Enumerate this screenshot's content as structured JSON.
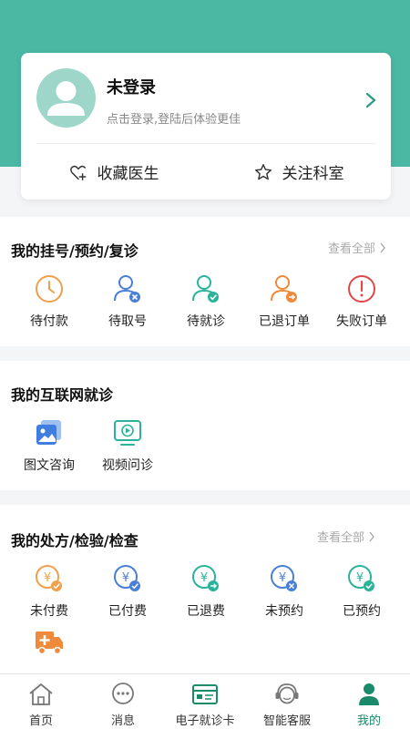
{
  "colors": {
    "hero": "#4ab8a3",
    "accent": "#1a8a6a",
    "clock": "#f0a04b",
    "blue": "#4a7fd8",
    "teal": "#2bb39a",
    "orange": "#f08a3b",
    "red": "#e04848"
  },
  "login_card": {
    "title": "未登录",
    "subtitle": "点击登录,登陆后体验更佳",
    "actions": [
      {
        "label": "收藏医生",
        "icon": "heart-plus-icon"
      },
      {
        "label": "关注科室",
        "icon": "star-outline-icon"
      }
    ]
  },
  "registration": {
    "title": "我的挂号/预约/复诊",
    "view_all": "查看全部",
    "items": [
      {
        "label": "待付款",
        "icon": "clock-icon"
      },
      {
        "label": "待取号",
        "icon": "user-cancel-icon"
      },
      {
        "label": "待就诊",
        "icon": "user-check-icon"
      },
      {
        "label": "已退订单",
        "icon": "user-return-icon"
      },
      {
        "label": "失败订单",
        "icon": "alert-circle-icon"
      }
    ]
  },
  "online": {
    "title": "我的互联网就诊",
    "items": [
      {
        "label": "图文咨询",
        "icon": "image-consult-icon"
      },
      {
        "label": "视频问诊",
        "icon": "video-consult-icon"
      }
    ]
  },
  "prescription": {
    "title": "我的处方/检验/检查",
    "view_all": "查看全部",
    "items": [
      {
        "label": "未付费",
        "icon": "yuan-pending-icon"
      },
      {
        "label": "已付费",
        "icon": "yuan-paid-icon"
      },
      {
        "label": "已退费",
        "icon": "yuan-refund-icon"
      },
      {
        "label": "未预约",
        "icon": "yuan-unbooked-icon"
      },
      {
        "label": "已预约",
        "icon": "yuan-booked-icon"
      }
    ],
    "extra_icon": "medical-truck-icon"
  },
  "tabbar": {
    "items": [
      {
        "label": "首页",
        "icon": "home-icon"
      },
      {
        "label": "消息",
        "icon": "message-icon"
      },
      {
        "label": "电子就诊卡",
        "icon": "card-icon"
      },
      {
        "label": "智能客服",
        "icon": "service-icon"
      },
      {
        "label": "我的",
        "icon": "profile-icon",
        "active": true
      }
    ]
  }
}
